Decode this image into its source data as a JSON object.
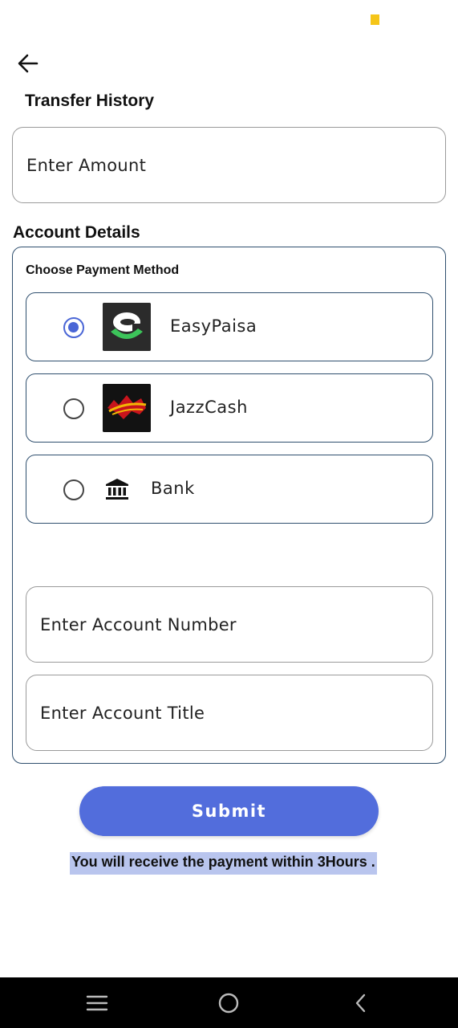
{
  "header": {
    "title": "Transfer History"
  },
  "amount": {
    "placeholder": "Enter Amount"
  },
  "account": {
    "title": "Account Details",
    "choose_label": "Choose Payment Method",
    "methods": [
      {
        "label": "EasyPaisa",
        "icon": "easypaisa-logo",
        "selected": true
      },
      {
        "label": "JazzCash",
        "icon": "jazzcash-logo",
        "selected": false
      },
      {
        "label": "Bank",
        "icon": "bank-icon",
        "selected": false
      }
    ],
    "account_number_placeholder": "Enter Account Number",
    "account_title_placeholder": "Enter Account Title"
  },
  "submit_label": "Submit",
  "notice": "You will receive the payment within 3Hours .",
  "nav": {
    "icons": [
      "menu-icon",
      "home-icon",
      "back-icon"
    ]
  },
  "colors": {
    "accent": "#526ddc",
    "radio_selected": "#4a66d6",
    "highlight": "#b9c5ee",
    "status_indicator": "#f5c518",
    "card_border": "#2f4f6e"
  }
}
